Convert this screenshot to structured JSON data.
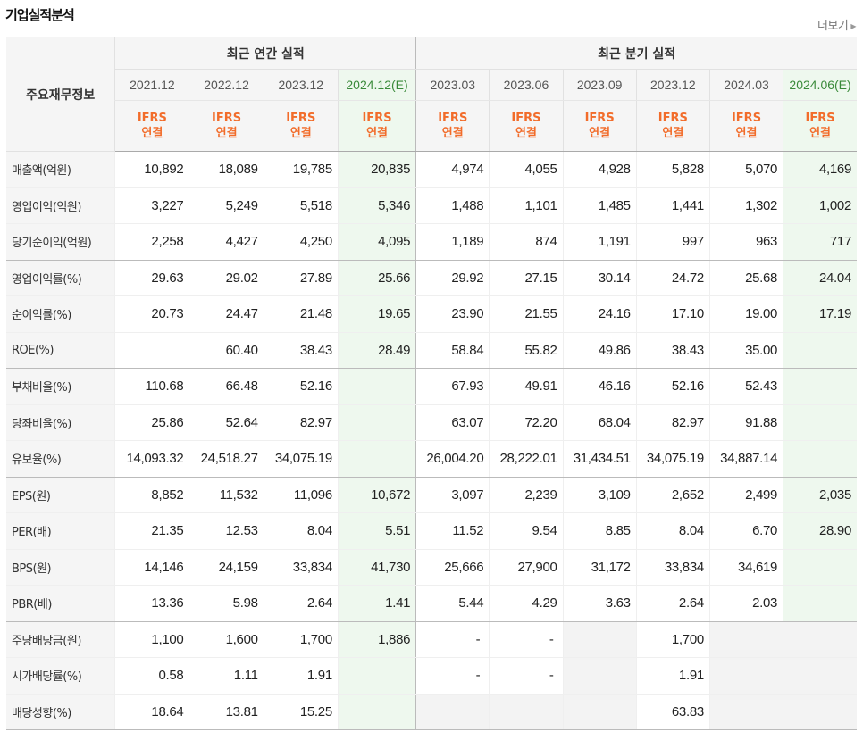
{
  "section": {
    "title": "기업실적분석",
    "more_label": "더보기"
  },
  "header": {
    "row_head": "주요재무정보",
    "group_annual": "최근 연간 실적",
    "group_quarterly": "최근 분기 실적",
    "periods": [
      "2021.12",
      "2022.12",
      "2023.12",
      "2024.12(E)",
      "2023.03",
      "2023.06",
      "2023.09",
      "2023.12",
      "2024.03",
      "2024.06(E)"
    ],
    "basis_top": "IFRS",
    "basis_bottom": "연결"
  },
  "rows": [
    {
      "label": "매출액(억원)",
      "values": [
        "10,892",
        "18,089",
        "19,785",
        "20,835",
        "4,974",
        "4,055",
        "4,928",
        "5,828",
        "5,070",
        "4,169"
      ]
    },
    {
      "label": "영업이익(억원)",
      "values": [
        "3,227",
        "5,249",
        "5,518",
        "5,346",
        "1,488",
        "1,101",
        "1,485",
        "1,441",
        "1,302",
        "1,002"
      ]
    },
    {
      "label": "당기순이익(억원)",
      "values": [
        "2,258",
        "4,427",
        "4,250",
        "4,095",
        "1,189",
        "874",
        "1,191",
        "997",
        "963",
        "717"
      ]
    },
    {
      "label": "영업이익률(%)",
      "values": [
        "29.63",
        "29.02",
        "27.89",
        "25.66",
        "29.92",
        "27.15",
        "30.14",
        "24.72",
        "25.68",
        "24.04"
      ]
    },
    {
      "label": "순이익률(%)",
      "values": [
        "20.73",
        "24.47",
        "21.48",
        "19.65",
        "23.90",
        "21.55",
        "24.16",
        "17.10",
        "19.00",
        "17.19"
      ]
    },
    {
      "label": "ROE(%)",
      "values": [
        "",
        "60.40",
        "38.43",
        "28.49",
        "58.84",
        "55.82",
        "49.86",
        "38.43",
        "35.00",
        ""
      ]
    },
    {
      "label": "부채비율(%)",
      "values": [
        "110.68",
        "66.48",
        "52.16",
        "",
        "67.93",
        "49.91",
        "46.16",
        "52.16",
        "52.43",
        ""
      ]
    },
    {
      "label": "당좌비율(%)",
      "values": [
        "25.86",
        "52.64",
        "82.97",
        "",
        "63.07",
        "72.20",
        "68.04",
        "82.97",
        "91.88",
        ""
      ]
    },
    {
      "label": "유보율(%)",
      "values": [
        "14,093.32",
        "24,518.27",
        "34,075.19",
        "",
        "26,004.20",
        "28,222.01",
        "31,434.51",
        "34,075.19",
        "34,887.14",
        ""
      ]
    },
    {
      "label": "EPS(원)",
      "values": [
        "8,852",
        "11,532",
        "11,096",
        "10,672",
        "3,097",
        "2,239",
        "3,109",
        "2,652",
        "2,499",
        "2,035"
      ]
    },
    {
      "label": "PER(배)",
      "values": [
        "21.35",
        "12.53",
        "8.04",
        "5.51",
        "11.52",
        "9.54",
        "8.85",
        "8.04",
        "6.70",
        "28.90"
      ]
    },
    {
      "label": "BPS(원)",
      "values": [
        "14,146",
        "24,159",
        "33,834",
        "41,730",
        "25,666",
        "27,900",
        "31,172",
        "33,834",
        "34,619",
        ""
      ]
    },
    {
      "label": "PBR(배)",
      "values": [
        "13.36",
        "5.98",
        "2.64",
        "1.41",
        "5.44",
        "4.29",
        "3.63",
        "2.64",
        "2.03",
        ""
      ]
    },
    {
      "label": "주당배당금(원)",
      "values": [
        "1,100",
        "1,600",
        "1,700",
        "1,886",
        "-",
        "-",
        "",
        "1,700",
        "",
        ""
      ]
    },
    {
      "label": "시가배당률(%)",
      "values": [
        "0.58",
        "1.11",
        "1.91",
        "",
        "-",
        "-",
        "",
        "1.91",
        "",
        ""
      ]
    },
    {
      "label": "배당성향(%)",
      "values": [
        "18.64",
        "13.81",
        "15.25",
        "",
        "",
        "",
        "",
        "63.83",
        "",
        ""
      ]
    }
  ],
  "colors": {
    "estimate_bg": "#eef8ee",
    "ifrs": "#f26c2a",
    "header_bg": "#f5f5f5",
    "empty_bg": "#f3f3f3"
  }
}
